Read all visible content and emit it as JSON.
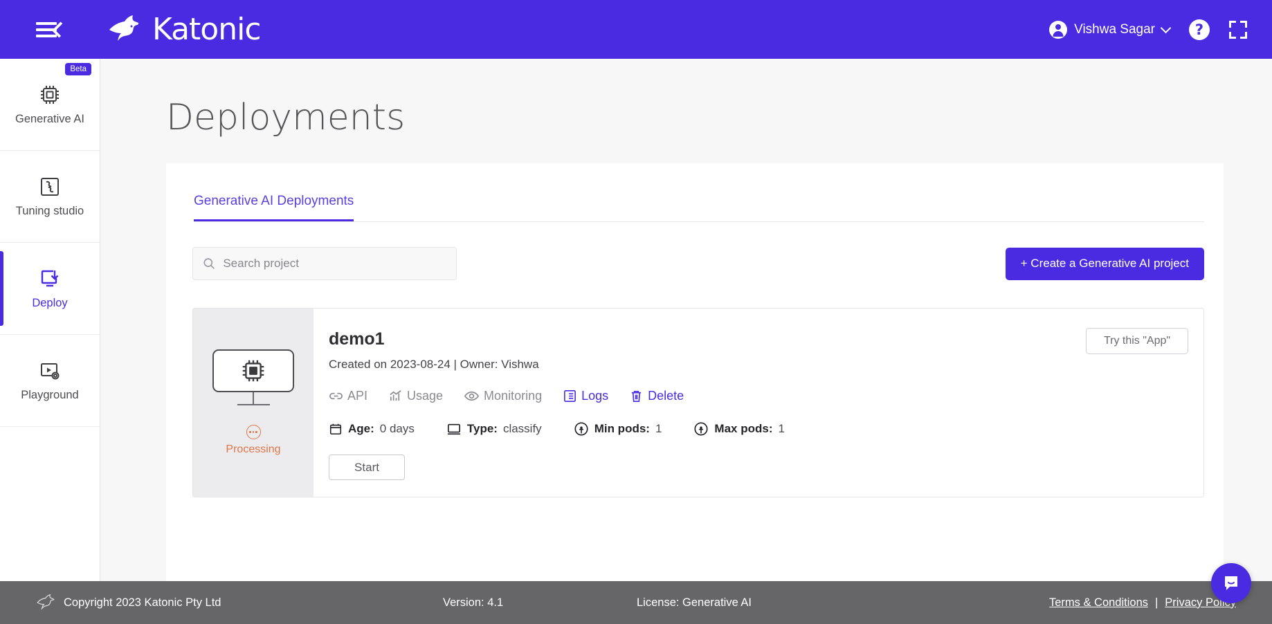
{
  "header": {
    "menu_icon": "hamburger-collapse-icon",
    "brand_name": "Katonic",
    "user_name": "Vishwa Sagar",
    "help_label": "?",
    "icons": [
      "account-circle-icon",
      "chevron-down-icon",
      "help-circle-icon",
      "fullscreen-icon"
    ]
  },
  "sidebar": {
    "items": [
      {
        "label": "Generative AI",
        "icon": "ai-chip-icon",
        "badge": "Beta",
        "active": false
      },
      {
        "label": "Tuning studio",
        "icon": "puzzle-icon",
        "badge": "",
        "active": false
      },
      {
        "label": "Deploy",
        "icon": "deploy-download-icon",
        "badge": "",
        "active": true
      },
      {
        "label": "Playground",
        "icon": "play-settings-icon",
        "badge": "",
        "active": false
      }
    ]
  },
  "main": {
    "page_title": "Deployments",
    "tabs": [
      {
        "label": "Generative AI Deployments",
        "active": true
      }
    ],
    "search": {
      "placeholder": "Search project",
      "value": "",
      "icon": "search-icon"
    },
    "create_button": {
      "label": "+ Create a Generative AI project"
    },
    "deployments": [
      {
        "name": "demo1",
        "subtitle": "Created on 2023-08-24 | Owner: Vishwa",
        "status": "Processing",
        "status_icon": "processing-dots-icon",
        "thumbnail_icon": "ai-monitor-icon",
        "try_button": "Try this \"App\"",
        "start_button": "Start",
        "actions": [
          {
            "label": "API",
            "icon": "link-icon",
            "state": "muted"
          },
          {
            "label": "Usage",
            "icon": "chart-usage-icon",
            "state": "muted"
          },
          {
            "label": "Monitoring",
            "icon": "eye-icon",
            "state": "muted"
          },
          {
            "label": "Logs",
            "icon": "list-logs-icon",
            "state": "link"
          },
          {
            "label": "Delete",
            "icon": "trash-icon",
            "state": "link"
          }
        ],
        "meta": [
          {
            "icon": "calendar-icon",
            "key": "Age:",
            "value": "0 days"
          },
          {
            "icon": "monitor-icon",
            "key": "Type:",
            "value": "classify"
          },
          {
            "icon": "pods-icon",
            "key": "Min pods:",
            "value": "1"
          },
          {
            "icon": "pods-icon",
            "key": "Max pods:",
            "value": "1"
          }
        ]
      }
    ]
  },
  "footer": {
    "copyright": "Copyright 2023 Katonic Pty Ltd",
    "version": "Version: 4.1",
    "license": "License: Generative AI",
    "terms_link": "Terms & Conditions",
    "separator": "|",
    "privacy_link": "Privacy Policy",
    "logo_icon": "kangaroo-icon"
  },
  "chat": {
    "icon": "chat-bubble-smile-icon"
  },
  "colors": {
    "brand_purple": "#4a2be2",
    "status_orange": "#e2764a",
    "footer_gray": "#666669",
    "page_bg": "#f7f7f8",
    "card_panel_gray": "#ececee"
  }
}
